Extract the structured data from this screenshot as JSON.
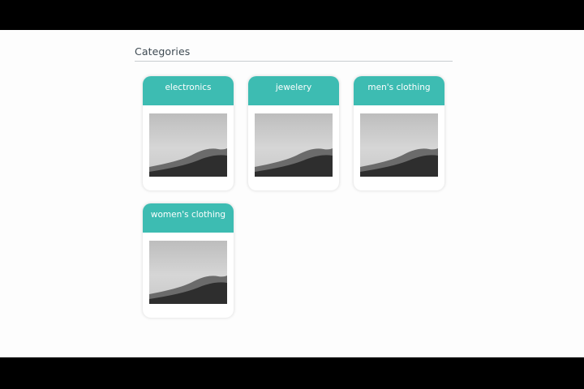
{
  "page": {
    "title": "Categories"
  },
  "colors": {
    "accent": "#3dbcb2",
    "background": "#fdfdfd",
    "title_text": "#3e4a52"
  },
  "categories": [
    {
      "name": "electronics",
      "image_icon": "landscape-photo"
    },
    {
      "name": "jewelery",
      "image_icon": "landscape-photo"
    },
    {
      "name": "men's clothing",
      "image_icon": "landscape-photo"
    },
    {
      "name": "women's clothing",
      "image_icon": "landscape-photo"
    }
  ]
}
